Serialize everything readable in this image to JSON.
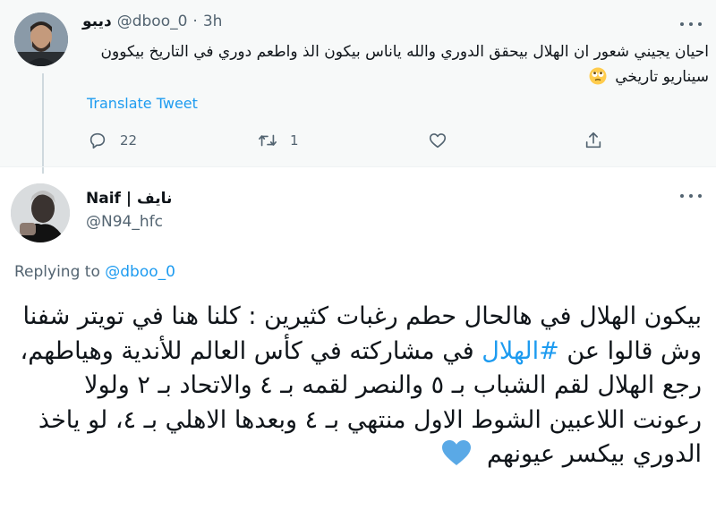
{
  "tweet_1": {
    "display_name": "ديبو",
    "handle": "@dboo_0",
    "separator": "·",
    "time": "3h",
    "text": "احيان يجيني شعور ان الهلال بيحقق الدوري والله ياناس بيكون الذ واطعم دوري في التاريخ بيكوون سيناريو تاريخي",
    "emoji": "rolling-eyes-face",
    "translate_label": "Translate Tweet",
    "reply_count": "22",
    "retweet_count": "1"
  },
  "tweet_2": {
    "display_name": "Naif | نايف",
    "handle": "@N94_hfc",
    "replying_prefix": "Replying to",
    "replying_to": "@dboo_0",
    "text_before_hashtag": "بيكون الهلال في هالحال حطم رغبات كثيرين : كلنا هنا في تويتر شفنا وش قالوا عن",
    "hashtag": "#الهلال",
    "text_after_hashtag": "في مشاركته في كأس العالم للأندية وهياطهم، رجع الهلال لقم الشباب بـ ٥ والنصر لقمه بـ ٤ والاتحاد بـ ٢ ولولا رعونت اللاعبين الشوط الاول منتهي بـ ٤ وبعدها الاهلي بـ ٤، لو ياخذ الدوري بيكسر عيونهم",
    "emoji": "blue-heart"
  },
  "colors": {
    "accent": "#1d9bf0",
    "muted": "#536471",
    "text": "#0f1419",
    "thread_background": "#f7f9f9",
    "heart": "#5aa9e6"
  }
}
